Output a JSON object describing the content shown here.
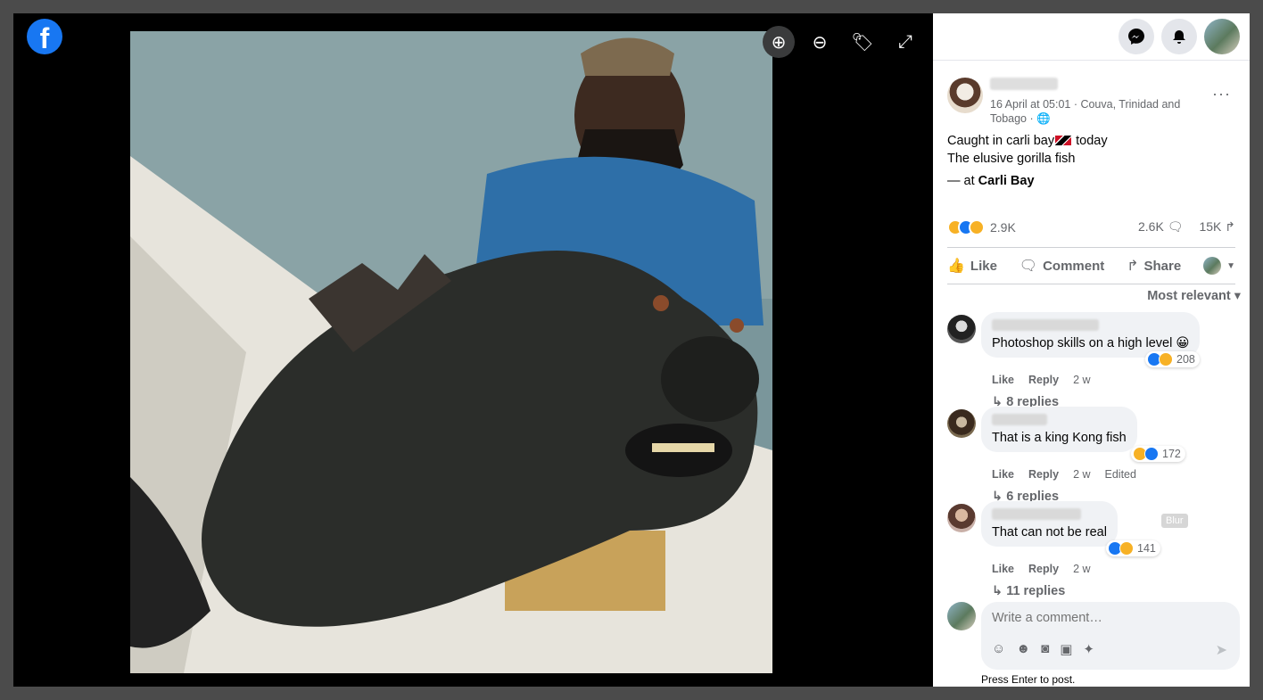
{
  "viewer": {
    "logo": "f",
    "tools": [
      {
        "icon": "zoom-in-icon",
        "glyph": "⊕"
      },
      {
        "icon": "zoom-out-icon",
        "glyph": "⊖"
      },
      {
        "icon": "tag-icon",
        "glyph": "🏷"
      },
      {
        "icon": "fullscreen-icon",
        "glyph": "⤢"
      }
    ]
  },
  "post": {
    "date_location": "16 April at 05:01 · Couva, Trinidad and Tobago · 🌐",
    "more": "···",
    "line1_a": "Caught in carli bay",
    "line1_b": " today",
    "line2": "The elusive gorilla fish",
    "at_prefix": "— at ",
    "place": "Carli Bay",
    "reactions": "2.9K",
    "comments": "2.6K 🗨",
    "shares": "15K ↱"
  },
  "actions": {
    "like": "Like",
    "comment": "Comment",
    "share": "Share"
  },
  "sort_label": "Most relevant ▾",
  "comments": [
    {
      "text": "Photoshop skills on a high level 😀",
      "reacts": "208",
      "like": "Like",
      "reply": "Reply",
      "time": "2 w",
      "edited": "",
      "replies": "8 replies"
    },
    {
      "text": "That is a king Kong fish",
      "reacts": "172",
      "like": "Like",
      "reply": "Reply",
      "time": "2 w",
      "edited": "Edited",
      "replies": "6 replies"
    },
    {
      "text": "That can not be real",
      "reacts": "141",
      "like": "Like",
      "reply": "Reply",
      "time": "2 w",
      "edited": "",
      "replies": "11 replies"
    }
  ],
  "blur_tag": "Blur",
  "composer": {
    "placeholder": "Write a comment…",
    "hint": "Press Enter to post."
  },
  "colors": {
    "brand": "#1877f2",
    "haha": "#f7b125"
  }
}
